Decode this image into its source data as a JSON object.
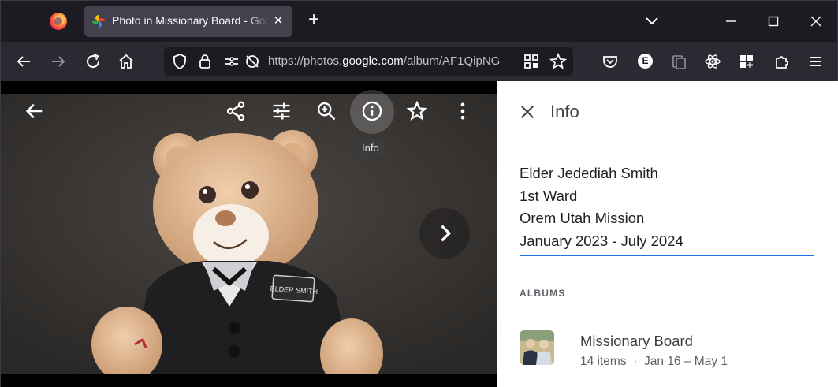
{
  "browser": {
    "tab_title": "Photo in Missionary Board - Google Photos",
    "tab_close": "✕",
    "new_tab": "+",
    "url_prefix": "https://photos.",
    "url_host": "google.com",
    "url_path": "/album/AF1QipNG",
    "account_initial": "E"
  },
  "viewer": {
    "tooltip": "Info",
    "tools": [
      "back-arrow-icon",
      "share-icon",
      "edit-tune-icon",
      "zoom-in-icon",
      "info-icon",
      "star-icon",
      "more-vert-icon"
    ],
    "nametag_text": "ELDER SMITH"
  },
  "info_panel": {
    "title": "Info",
    "description_lines": [
      "Elder Jedediah Smith",
      "1st Ward",
      "Orem Utah Mission",
      "January 2023 - July 2024"
    ],
    "albums_heading": "ALBUMS",
    "album": {
      "name": "Missionary Board",
      "items": "14 items",
      "separator": "·",
      "date_range": "Jan 16 – May 1"
    }
  },
  "colors": {
    "accent": "#1a73e8",
    "browser_bg": "#1c1b22",
    "toolbar_bg": "#2b2a33"
  }
}
